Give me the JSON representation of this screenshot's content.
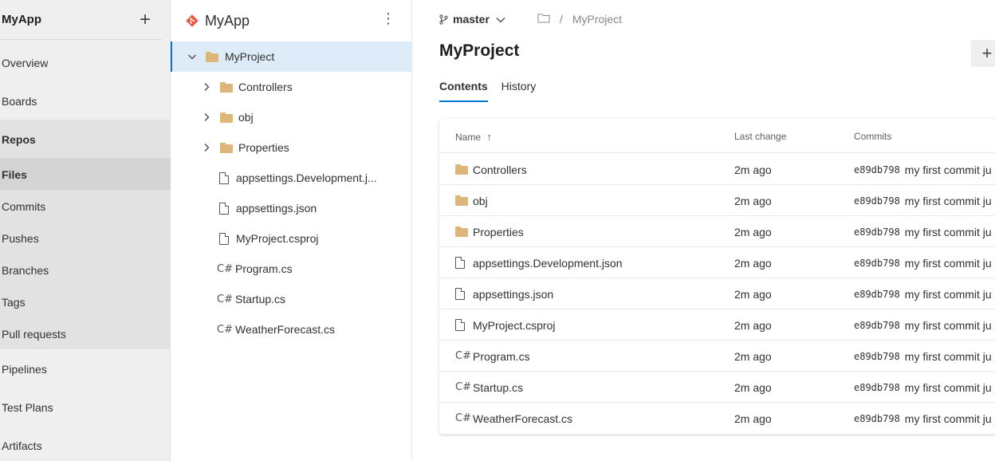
{
  "leftnav": {
    "project": "MyApp",
    "items": [
      {
        "label": "Overview"
      },
      {
        "label": "Boards"
      },
      {
        "label": "Repos"
      },
      {
        "label": "Files"
      },
      {
        "label": "Commits"
      },
      {
        "label": "Pushes"
      },
      {
        "label": "Branches"
      },
      {
        "label": "Tags"
      },
      {
        "label": "Pull requests"
      },
      {
        "label": "Pipelines"
      },
      {
        "label": "Test Plans"
      },
      {
        "label": "Artifacts"
      }
    ]
  },
  "tree": {
    "repo": "MyApp",
    "root": "MyProject",
    "items": [
      {
        "label": "Controllers",
        "type": "folder"
      },
      {
        "label": "obj",
        "type": "folder"
      },
      {
        "label": "Properties",
        "type": "folder"
      },
      {
        "label": "appsettings.Development.j...",
        "type": "file"
      },
      {
        "label": "appsettings.json",
        "type": "file"
      },
      {
        "label": "MyProject.csproj",
        "type": "file"
      },
      {
        "label": "Program.cs",
        "type": "csharp"
      },
      {
        "label": "Startup.cs",
        "type": "csharp"
      },
      {
        "label": "WeatherForecast.cs",
        "type": "csharp"
      }
    ]
  },
  "main": {
    "branch": "master",
    "breadcrumb_sep": "/",
    "breadcrumb_item": "MyProject",
    "title": "MyProject",
    "tabs": [
      {
        "label": "Contents"
      },
      {
        "label": "History"
      }
    ],
    "table": {
      "headers": {
        "name": "Name",
        "last_change": "Last change",
        "commits": "Commits"
      },
      "sort_indicator": "↑",
      "rows": [
        {
          "name": "Controllers",
          "type": "folder",
          "time": "2m ago",
          "hash": "e89db798",
          "msg": "my first commit ju"
        },
        {
          "name": "obj",
          "type": "folder",
          "time": "2m ago",
          "hash": "e89db798",
          "msg": "my first commit ju"
        },
        {
          "name": "Properties",
          "type": "folder",
          "time": "2m ago",
          "hash": "e89db798",
          "msg": "my first commit ju"
        },
        {
          "name": "appsettings.Development.json",
          "type": "file",
          "time": "2m ago",
          "hash": "e89db798",
          "msg": "my first commit ju"
        },
        {
          "name": "appsettings.json",
          "type": "file",
          "time": "2m ago",
          "hash": "e89db798",
          "msg": "my first commit ju"
        },
        {
          "name": "MyProject.csproj",
          "type": "file",
          "time": "2m ago",
          "hash": "e89db798",
          "msg": "my first commit ju"
        },
        {
          "name": "Program.cs",
          "type": "csharp",
          "time": "2m ago",
          "hash": "e89db798",
          "msg": "my first commit ju"
        },
        {
          "name": "Startup.cs",
          "type": "csharp",
          "time": "2m ago",
          "hash": "e89db798",
          "msg": "my first commit ju"
        },
        {
          "name": "WeatherForecast.cs",
          "type": "csharp",
          "time": "2m ago",
          "hash": "e89db798",
          "msg": "my first commit ju"
        }
      ]
    }
  },
  "icons": {
    "plus": "+",
    "kebab": "⋮",
    "csharp": "C#",
    "chevron_right": "›"
  },
  "colors": {
    "accent": "#0078d4",
    "folder": "#dcb67a",
    "selected_bg": "#deecf9",
    "repo_icon": "#e05d44"
  }
}
